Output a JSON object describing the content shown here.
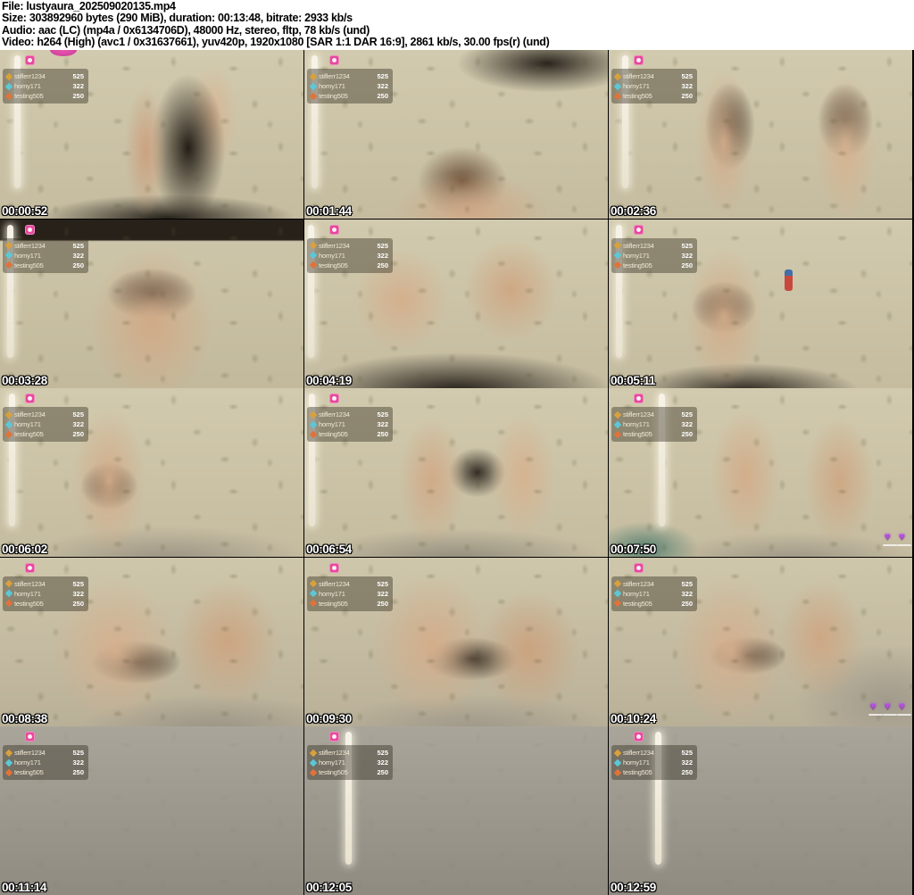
{
  "header": {
    "file": "File: lustyaura_202509020135.mp4",
    "size": "Size: 303892960 bytes (290 MiB), duration: 00:13:48, bitrate: 2933 kb/s",
    "audio": "Audio: aac (LC) (mp4a / 0x6134706D), 48000 Hz, stereo, fltp, 78 kb/s (und)",
    "video": "Video: h264 (High) (avc1 / 0x31637661), yuv420p, 1920x1080 [SAR 1:1 DAR 16:9], 2861 kb/s, 30.00 fps(r) (und)"
  },
  "stream_overlay": {
    "logo_icon": "pink-cam-logo-icon",
    "tippers": [
      {
        "badge_icon": "gold-badge-icon",
        "name": "stiflerr1234",
        "amount": "525"
      },
      {
        "badge_icon": "teal-badge-icon",
        "name": "horny171",
        "amount": "322"
      },
      {
        "badge_icon": "orange-badge-icon",
        "name": "testing505",
        "amount": "250"
      }
    ],
    "colors": {
      "logo_pink": "#e8489c",
      "badge_gold": "#d9a13c",
      "badge_teal": "#5bc8d8",
      "badge_orange": "#e0733a",
      "hearts_purple": "#b44fe0"
    }
  },
  "thumbnails": [
    {
      "timestamp": "00:00:52"
    },
    {
      "timestamp": "00:01:44"
    },
    {
      "timestamp": "00:02:36"
    },
    {
      "timestamp": "00:03:28"
    },
    {
      "timestamp": "00:04:19"
    },
    {
      "timestamp": "00:05:11"
    },
    {
      "timestamp": "00:06:02"
    },
    {
      "timestamp": "00:06:54"
    },
    {
      "timestamp": "00:07:50"
    },
    {
      "timestamp": "00:08:38"
    },
    {
      "timestamp": "00:09:30"
    },
    {
      "timestamp": "00:10:24"
    },
    {
      "timestamp": "00:11:14"
    },
    {
      "timestamp": "00:12:05"
    },
    {
      "timestamp": "00:12:59"
    }
  ]
}
